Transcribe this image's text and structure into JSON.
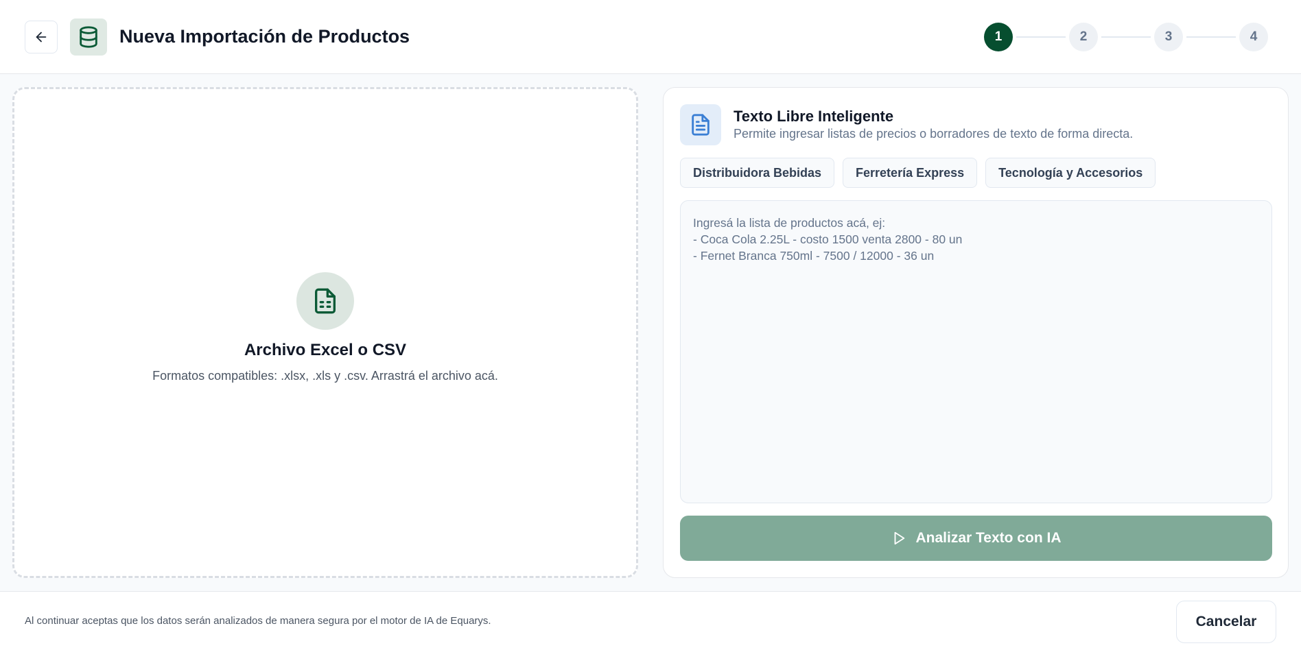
{
  "header": {
    "back_icon": "arrow-left-icon",
    "app_icon": "database-icon",
    "title": "Nueva Importación de Productos"
  },
  "stepper": {
    "steps": [
      "1",
      "2",
      "3",
      "4"
    ],
    "active_step": 1,
    "active_color": "#064e2f"
  },
  "file_upload": {
    "icon": "spreadsheet-file-icon",
    "title": "Archivo Excel o CSV",
    "subtitle": "Formatos compatibles: .xlsx, .xls y .csv. Arrastrá el archivo acá."
  },
  "text_import": {
    "icon": "document-icon",
    "title": "Texto Libre Inteligente",
    "subtitle": "Permite ingresar listas de precios o borradores de texto de forma directa.",
    "templates": [
      "Distribuidora Bebidas",
      "Ferretería Express",
      "Tecnología y Accesorios"
    ],
    "value": "",
    "placeholder": "Ingresá la lista de productos acá, ej:\n- Coca Cola 2.25L - costo 1500 venta 2800 - 80 un\n- Fernet Branca 750ml - 7500 / 12000 - 36 un",
    "analyze_icon": "play-icon",
    "analyze_label": "Analizar Texto con IA",
    "analyze_color": "#80aa98"
  },
  "footer": {
    "note": "Al continuar aceptas que los datos serán analizados de manera segura por el motor de IA de Equarys.",
    "cancel_label": "Cancelar"
  }
}
